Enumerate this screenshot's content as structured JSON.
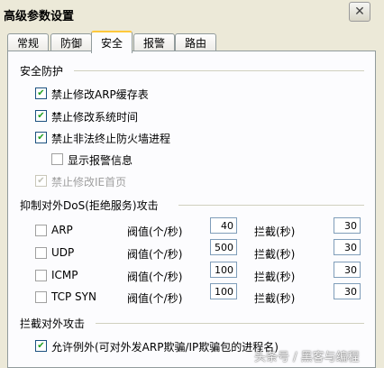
{
  "window": {
    "title": "高级参数设置",
    "close_glyph": "✕"
  },
  "tabs": [
    "常规",
    "防御",
    "安全",
    "报警",
    "路由"
  ],
  "active_tab": "安全",
  "security": {
    "group_title": "安全防护",
    "items": [
      {
        "label": "禁止修改ARP缓存表",
        "checked": true,
        "enabled": true
      },
      {
        "label": "禁止修改系统时间",
        "checked": true,
        "enabled": true
      },
      {
        "label": "禁止非法终止防火墙进程",
        "checked": true,
        "enabled": true
      },
      {
        "label": "显示报警信息",
        "checked": false,
        "enabled": true
      },
      {
        "label": "禁止修改IE首页",
        "checked": true,
        "enabled": false
      }
    ]
  },
  "dos": {
    "group_title": "抑制对外DoS(拒绝服务)攻击",
    "threshold_label": "阀值(个/秒)",
    "intercept_label": "拦截(秒)",
    "rows": [
      {
        "protocol": "ARP",
        "checked": false,
        "threshold": "40",
        "intercept": "30"
      },
      {
        "protocol": "UDP",
        "checked": false,
        "threshold": "500",
        "intercept": "30"
      },
      {
        "protocol": "ICMP",
        "checked": false,
        "threshold": "100",
        "intercept": "30"
      },
      {
        "protocol": "TCP SYN",
        "checked": false,
        "threshold": "100",
        "intercept": "30"
      }
    ]
  },
  "outbound": {
    "group_title": "拦截对外攻击",
    "allow_label": "允许例外(可对外发ARP欺骗/IP欺骗包的进程名)",
    "allow_checked": true
  },
  "watermark": "头条号 / 黑客与编程"
}
